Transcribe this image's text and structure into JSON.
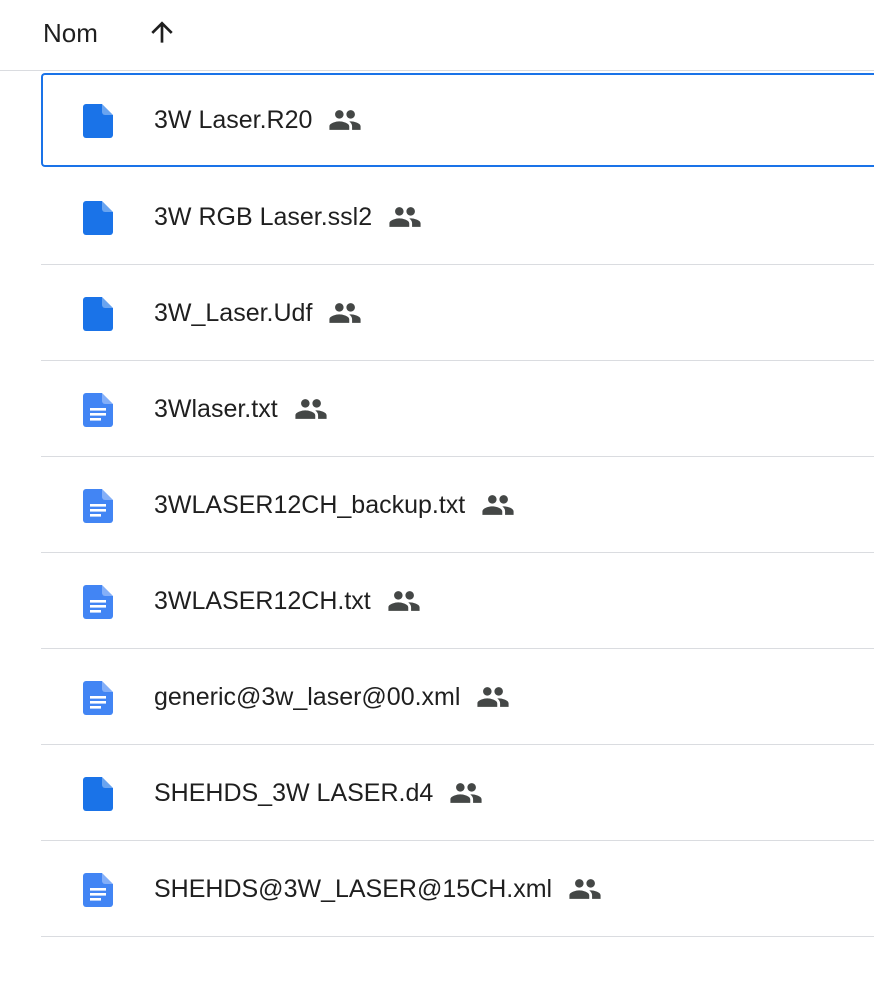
{
  "header": {
    "name_label": "Nom",
    "sort_icon": "arrow-up-icon"
  },
  "colors": {
    "binary_icon": "#1a73e8",
    "doc_icon": "#4285f4",
    "selection": "#1a73e8",
    "divider": "#dadce0",
    "shared_icon": "#444746"
  },
  "files": [
    {
      "name": "3W Laser.R20",
      "icon": "file-icon",
      "shared": true,
      "selected": true
    },
    {
      "name": "3W RGB Laser.ssl2",
      "icon": "file-icon",
      "shared": true,
      "selected": false
    },
    {
      "name": "3W_Laser.Udf",
      "icon": "file-icon",
      "shared": true,
      "selected": false
    },
    {
      "name": "3Wlaser.txt",
      "icon": "text-document-icon",
      "shared": true,
      "selected": false
    },
    {
      "name": "3WLASER12CH_backup.txt",
      "icon": "text-document-icon",
      "shared": true,
      "selected": false
    },
    {
      "name": "3WLASER12CH.txt",
      "icon": "text-document-icon",
      "shared": true,
      "selected": false
    },
    {
      "name": "generic@3w_laser@00.xml",
      "icon": "text-document-icon",
      "shared": true,
      "selected": false
    },
    {
      "name": "SHEHDS_3W LASER.d4",
      "icon": "file-icon",
      "shared": true,
      "selected": false
    },
    {
      "name": "SHEHDS@3W_LASER@15CH.xml",
      "icon": "text-document-icon",
      "shared": true,
      "selected": false
    }
  ]
}
